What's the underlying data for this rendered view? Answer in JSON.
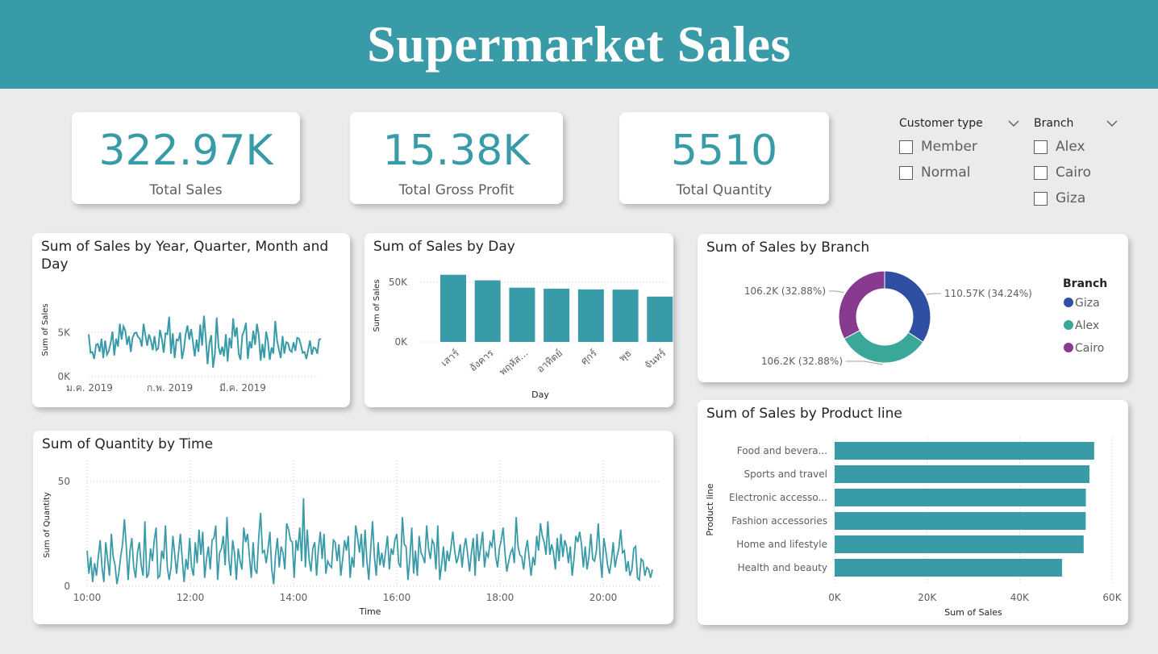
{
  "header": {
    "title": "Supermarket Sales"
  },
  "colors": {
    "accent": "#3a9ba8",
    "giza": "#2f4fa2",
    "alex": "#3aa899",
    "cairo": "#873a8e"
  },
  "kpis": [
    {
      "value": "322.97K",
      "label": "Total Sales"
    },
    {
      "value": "15.38K",
      "label": "Total Gross Profit"
    },
    {
      "value": "5510",
      "label": "Total Quantity"
    }
  ],
  "slicers": {
    "customer_type": {
      "title": "Customer type",
      "options": [
        "Member",
        "Normal"
      ]
    },
    "branch": {
      "title": "Branch",
      "options": [
        "Alex",
        "Cairo",
        "Giza"
      ]
    }
  },
  "visuals": {
    "sales_by_date": {
      "title": "Sum of Sales by Year, Quarter, Month and Day"
    },
    "sales_by_day": {
      "title": "Sum of Sales by Day"
    },
    "sales_by_branch": {
      "title": "Sum of Sales by Branch"
    },
    "quantity_by_time": {
      "title": "Sum of Quantity by Time"
    },
    "sales_by_product_line": {
      "title": "Sum of Sales by Product line"
    }
  },
  "chart_data": [
    {
      "type": "line",
      "title": "Sum of Sales by Year, Quarter, Month and Day",
      "xlabel": "",
      "ylabel": "Sum of Sales",
      "x_tick_labels": [
        "ม.ค. 2019",
        "ก.พ. 2019",
        "มี.ค. 2019"
      ],
      "y_tick_labels": [
        "0K",
        "5K"
      ],
      "ylim": [
        0,
        7500
      ],
      "series": [
        {
          "values": [
            4800,
            2700,
            2800,
            2000,
            3600,
            3700,
            2800,
            4300,
            2100,
            4100,
            2500,
            2900,
            3800,
            5100,
            2400,
            4300,
            3400,
            6000,
            4200,
            5700,
            5200,
            3600,
            4600,
            2800,
            4400,
            4900,
            5000,
            4500,
            4300,
            3400,
            6000,
            4700,
            3500,
            4800,
            4100,
            3000,
            4600,
            3000,
            3200,
            5300,
            4300,
            2700,
            4900,
            4800,
            6800,
            2600,
            4900,
            2100,
            4200,
            4100,
            5000,
            2000,
            3000,
            4800,
            5800,
            4200,
            5400,
            3900,
            2300,
            4200,
            2800,
            5900,
            3500,
            6900,
            4500,
            1400,
            3800,
            4700,
            1000,
            2600,
            6700,
            3400,
            2500,
            3400,
            2300,
            4800,
            1700,
            4400,
            3200,
            6600,
            4500,
            5600,
            2600,
            1900,
            4700,
            5200,
            6100,
            2000,
            4000,
            3200,
            5200,
            3600,
            6000,
            4700,
            1800,
            3700,
            2100,
            5100,
            4100,
            1900,
            3300,
            2600,
            6300,
            4100,
            3100,
            2100,
            4600,
            2600,
            3900,
            3800,
            3000,
            2800,
            3900,
            2900,
            4400,
            4300,
            3600,
            2700,
            2800,
            2000,
            3000,
            4100,
            2500,
            3300,
            3200,
            2600,
            4200,
            4300
          ]
        }
      ],
      "grid": true
    },
    {
      "type": "bar",
      "title": "Sum of Sales by Day",
      "xlabel": "Day",
      "ylabel": "Sum of Sales",
      "categories": [
        "เสาร์",
        "อังคาร",
        "พฤหัส...",
        "อาทิตย์",
        "ศุกร์",
        "พุธ",
        "จันทร์"
      ],
      "values": [
        56120,
        51480,
        45350,
        44460,
        43930,
        43730,
        37900
      ],
      "y_tick_labels": [
        "0K",
        "50K"
      ],
      "ylim": [
        0,
        60000
      ],
      "grid": true
    },
    {
      "type": "pie",
      "title": "Sum of Sales by Branch",
      "legend_title": "Branch",
      "legend_position": "right",
      "categories": [
        "Giza",
        "Alex",
        "Cairo"
      ],
      "values": [
        110570,
        106200,
        106200
      ],
      "labels": [
        "110.57K (34.24%)",
        "106.2K (32.88%)",
        "106.2K (32.88%)"
      ]
    },
    {
      "type": "line",
      "title": "Sum of Quantity by Time",
      "xlabel": "Time",
      "ylabel": "Sum of Quantity",
      "x_tick_labels": [
        "10:00",
        "12:00",
        "14:00",
        "16:00",
        "18:00",
        "20:00"
      ],
      "y_tick_labels": [
        "0",
        "50"
      ],
      "ylim": [
        0,
        60
      ],
      "series": [
        {
          "values": [
            17,
            6,
            14,
            2,
            11,
            5,
            14,
            22,
            9,
            2,
            21,
            13,
            5,
            25,
            14,
            10,
            1,
            6,
            14,
            20,
            32,
            19,
            3,
            17,
            23,
            9,
            4,
            16,
            21,
            10,
            5,
            31,
            4,
            6,
            18,
            12,
            22,
            28,
            4,
            5,
            17,
            13,
            29,
            9,
            3,
            9,
            24,
            15,
            6,
            16,
            25,
            13,
            2,
            13,
            8,
            23,
            9,
            5,
            21,
            11,
            27,
            15,
            26,
            4,
            13,
            19,
            8,
            22,
            23,
            29,
            3,
            16,
            18,
            24,
            10,
            33,
            13,
            5,
            22,
            16,
            3,
            18,
            12,
            8,
            28,
            21,
            25,
            14,
            4,
            21,
            8,
            6,
            23,
            35,
            16,
            17,
            11,
            18,
            26,
            8,
            1,
            15,
            23,
            9,
            19,
            16,
            8,
            30,
            27,
            22,
            21,
            4,
            22,
            17,
            28,
            12,
            42,
            9,
            27,
            13,
            7,
            18,
            21,
            5,
            18,
            26,
            13,
            25,
            6,
            12,
            10,
            9,
            22,
            21,
            12,
            20,
            5,
            13,
            22,
            17,
            24,
            4,
            14,
            9,
            29,
            23,
            16,
            25,
            9,
            27,
            12,
            3,
            18,
            31,
            14,
            5,
            21,
            10,
            16,
            9,
            17,
            24,
            8,
            18,
            15,
            22,
            25,
            11,
            9,
            33,
            20,
            19,
            3,
            13,
            28,
            6,
            17,
            5,
            24,
            16,
            14,
            11,
            29,
            18,
            13,
            22,
            20,
            8,
            29,
            3,
            10,
            19,
            7,
            17,
            12,
            18,
            26,
            17,
            11,
            14,
            20,
            9,
            18,
            23,
            15,
            7,
            16,
            23,
            5,
            25,
            12,
            19,
            26,
            9,
            16,
            14,
            21,
            19,
            27,
            14,
            9,
            18,
            22,
            28,
            16,
            7,
            12,
            16,
            18,
            11,
            33,
            19,
            15,
            14,
            8,
            17,
            22,
            13,
            5,
            14,
            10,
            24,
            17,
            30,
            24,
            21,
            15,
            31,
            15,
            20,
            16,
            8,
            23,
            12,
            25,
            14,
            22,
            19,
            11,
            19,
            5,
            13,
            24,
            21,
            26,
            20,
            9,
            19,
            8,
            14,
            25,
            13,
            12,
            17,
            30,
            14,
            4,
            23,
            17,
            10,
            6,
            12,
            21,
            9,
            14,
            18,
            27,
            16,
            17,
            7,
            12,
            5,
            8,
            18,
            19,
            4,
            3,
            13,
            12,
            5,
            9,
            8,
            4,
            8
          ]
        }
      ],
      "grid": true
    },
    {
      "type": "bar",
      "orientation": "horizontal",
      "title": "Sum of Sales by Product line",
      "xlabel": "Sum of Sales",
      "ylabel": "Product line",
      "categories": [
        "Food and bevera...",
        "Sports and travel",
        "Electronic accesso...",
        "Fashion accessories",
        "Home and lifestyle",
        "Health and beauty"
      ],
      "values": [
        56140,
        55120,
        54340,
        54310,
        53860,
        49190
      ],
      "x_tick_labels": [
        "0K",
        "20K",
        "40K",
        "60K"
      ],
      "xlim": [
        0,
        60000
      ],
      "grid": true
    }
  ]
}
